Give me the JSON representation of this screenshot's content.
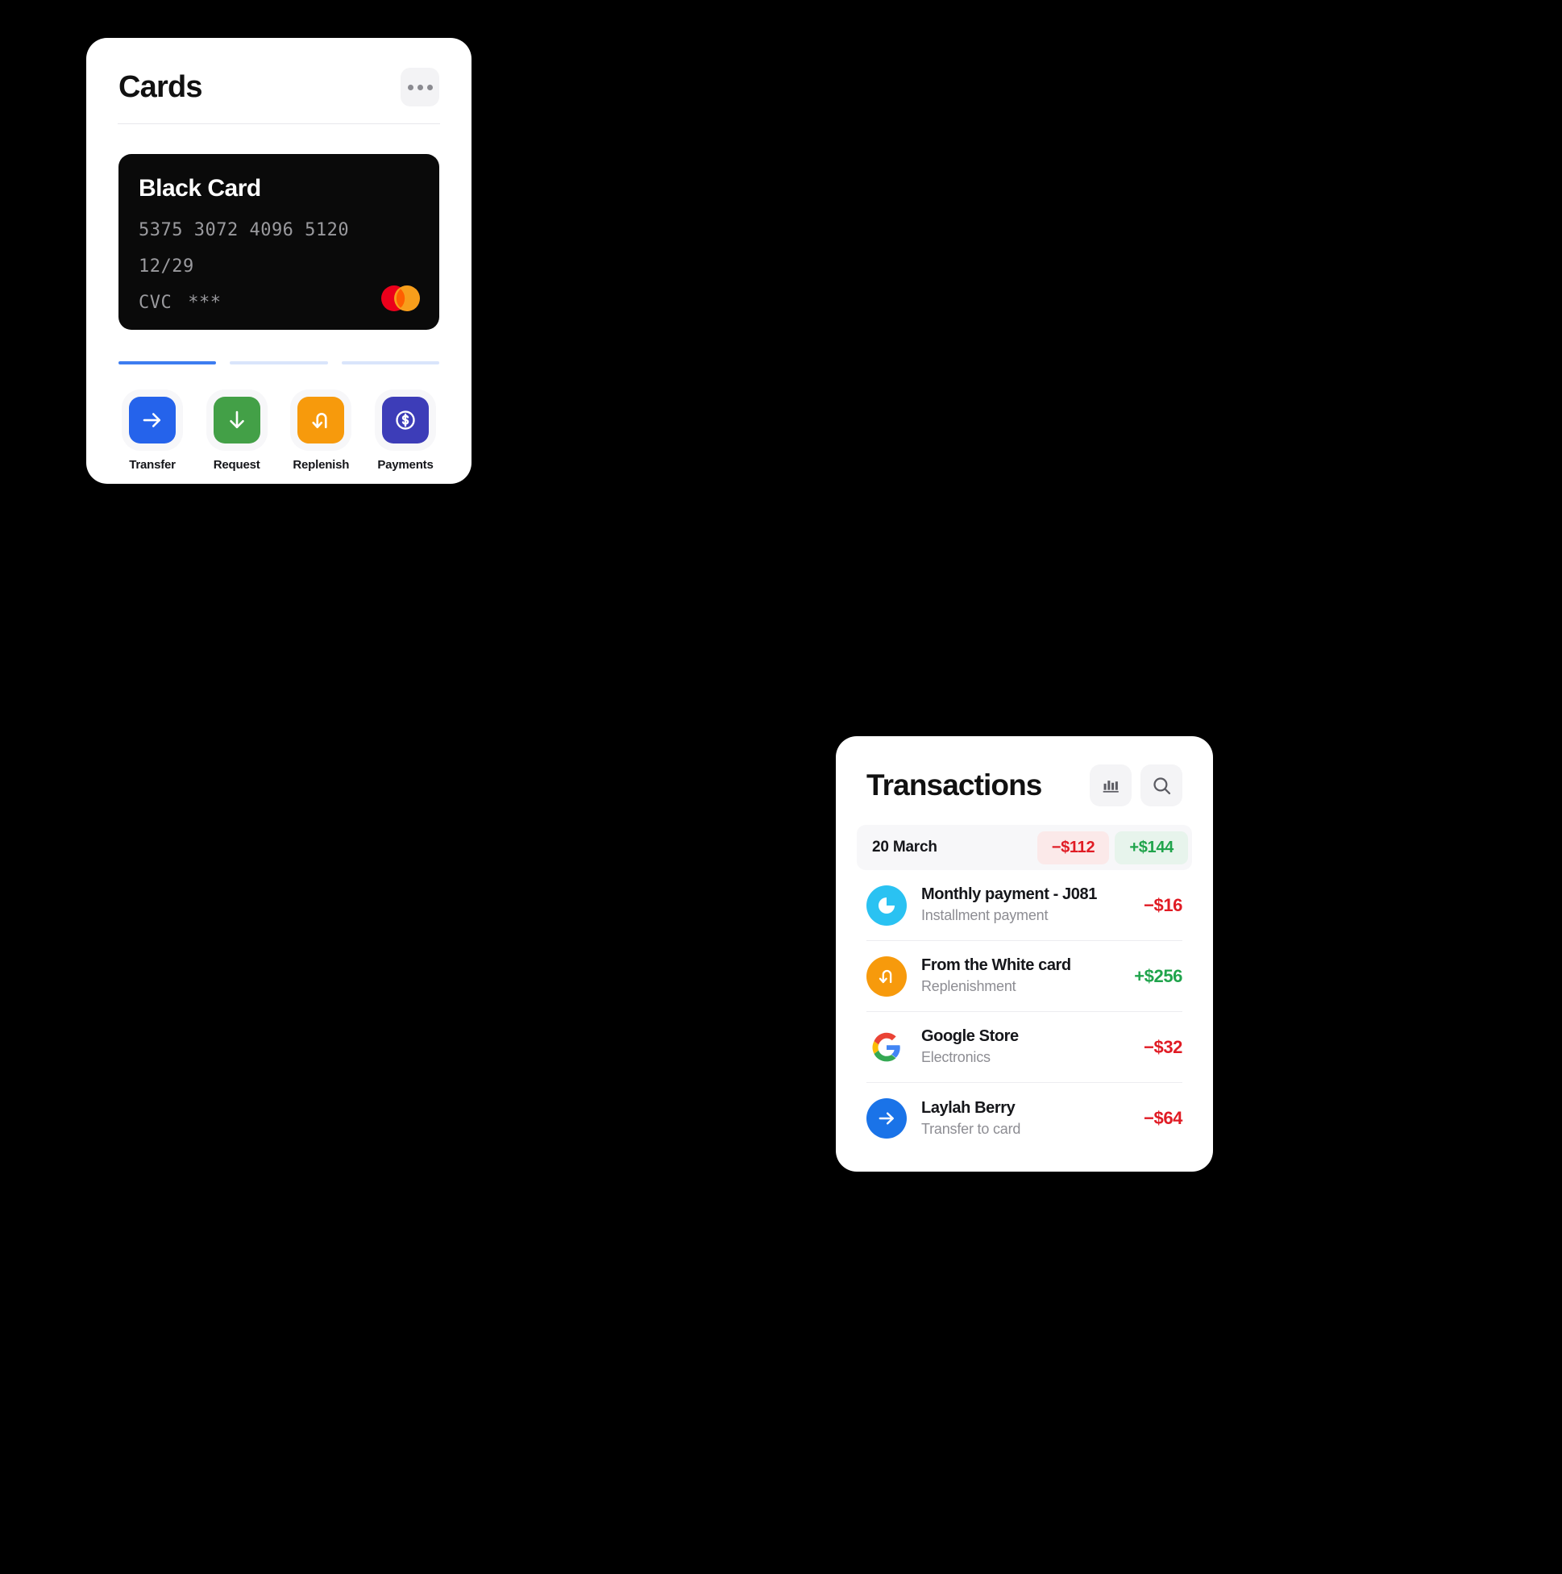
{
  "cards_panel": {
    "title": "Cards",
    "menu_icon": "more-horizontal-icon",
    "card": {
      "name": "Black Card",
      "number": "5375 3072 4096 5120",
      "expiry": "12/29",
      "cvc_label": "CVC",
      "cvc_value": "***",
      "brand": "mastercard",
      "background": "#0a0a0a"
    },
    "pagination": {
      "total": 3,
      "active_index": 0,
      "active_color": "#3d7df0",
      "inactive_color": "#d9e5fb"
    },
    "actions": [
      {
        "label": "Transfer",
        "icon": "arrow-right-icon",
        "color": "#2563eb"
      },
      {
        "label": "Request",
        "icon": "arrow-down-icon",
        "color": "#43a047"
      },
      {
        "label": "Replenish",
        "icon": "u-turn-arrow-icon",
        "color": "#f79a0c"
      },
      {
        "label": "Payments",
        "icon": "dollar-circle-icon",
        "color": "#3d3db8"
      }
    ]
  },
  "transactions_panel": {
    "title": "Transactions",
    "chart_button_icon": "bar-chart-icon",
    "search_button_icon": "search-icon",
    "day_summary": {
      "date": "20 March",
      "outgoing": "−$112",
      "incoming": "+$144",
      "outgoing_color": "#e01b24",
      "incoming_color": "#20a44c"
    },
    "items": [
      {
        "name": "Monthly payment - J081",
        "category": "Installment payment",
        "amount": "−$16",
        "direction": "negative",
        "icon": "pie-chart-icon",
        "avatar_color": "#2ac2f2"
      },
      {
        "name": "From the White card",
        "category": "Replenishment",
        "amount": "+$256",
        "direction": "positive",
        "icon": "u-turn-arrow-icon",
        "avatar_color": "#f79a0c"
      },
      {
        "name": "Google Store",
        "category": "Electronics",
        "amount": "−$32",
        "direction": "negative",
        "icon": "google-logo-icon",
        "avatar_color": "#ffffff"
      },
      {
        "name": "Laylah Berry",
        "category": "Transfer to card",
        "amount": "−$64",
        "direction": "negative",
        "icon": "arrow-right-icon",
        "avatar_color": "#1a73e8"
      }
    ]
  }
}
